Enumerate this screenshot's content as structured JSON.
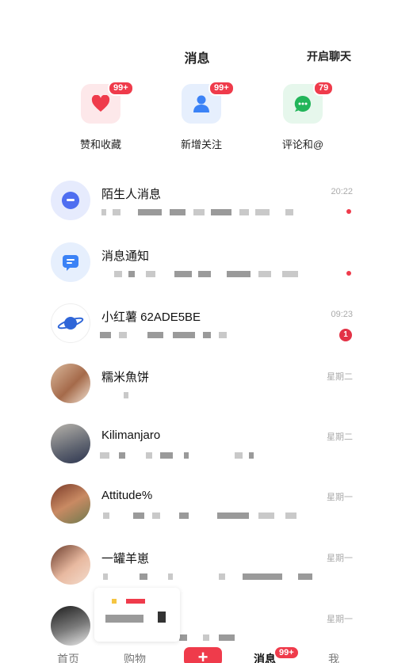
{
  "header": {
    "title": "消息",
    "action": "开启聊天"
  },
  "quick": [
    {
      "label": "赞和收藏",
      "badge": "99+",
      "icon": "heart-icon",
      "bg": "#fde8ea",
      "color": "#ef3b4b"
    },
    {
      "label": "新增关注",
      "badge": "99+",
      "icon": "person-icon",
      "bg": "#e6effd",
      "color": "#3b82f6"
    },
    {
      "label": "评论和@",
      "badge": "79",
      "icon": "chat-bubble-icon",
      "bg": "#e6f7ec",
      "color": "#22b55a"
    }
  ],
  "conversations": [
    {
      "name": "陌生人消息",
      "time": "20:22",
      "indicator": "dot",
      "avatar": "stranger-chat-icon"
    },
    {
      "name": "消息通知",
      "time": "",
      "indicator": "dot",
      "avatar": "notification-icon"
    },
    {
      "name": "小红薯 62ADE5BE",
      "time": "09:23",
      "indicator": "count",
      "count": "1",
      "avatar": "planet-icon"
    },
    {
      "name": "糯米魚饼",
      "time": "星期二",
      "avatar": "user-photo"
    },
    {
      "name": "Kilimanjaro",
      "time": "星期二",
      "avatar": "user-photo"
    },
    {
      "name": "Attitude%",
      "time": "星期一",
      "avatar": "user-photo"
    },
    {
      "name": "一罐羊崽",
      "time": "星期一",
      "avatar": "user-photo"
    },
    {
      "name": "",
      "time": "星期一",
      "avatar": "user-photo"
    }
  ],
  "tabbar": {
    "home": "首页",
    "shop": "购物",
    "plus": "+",
    "messages": "消息",
    "messages_badge": "99+",
    "me": "我"
  },
  "colors": {
    "accent": "#ef3b4b"
  }
}
